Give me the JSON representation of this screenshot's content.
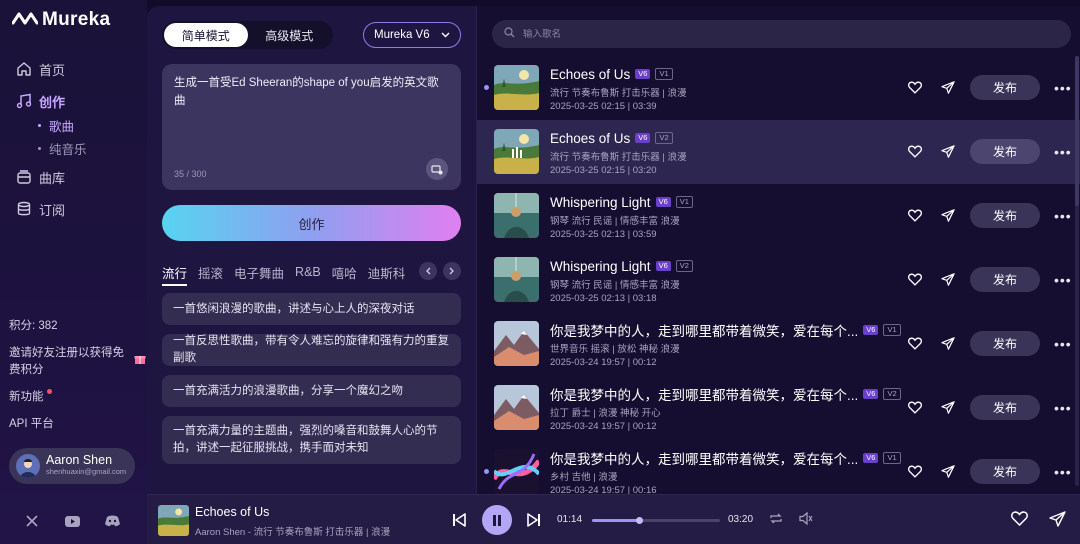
{
  "brand": {
    "name": "Mureka",
    "accent": "#c8a8ff"
  },
  "sidebar": {
    "nav": [
      {
        "label": "首页",
        "icon": "home-icon"
      },
      {
        "label": "创作",
        "icon": "music-note-icon",
        "active": true
      },
      {
        "label": "曲库",
        "icon": "library-icon"
      },
      {
        "label": "订阅",
        "icon": "database-icon"
      }
    ],
    "create_sub": [
      {
        "label": "歌曲",
        "active": true
      },
      {
        "label": "纯音乐"
      }
    ],
    "credits": "积分: 382",
    "invite": "邀请好友注册以获得免费积分",
    "new_features": "新功能",
    "api": "API 平台",
    "user": {
      "name": "Aaron Shen",
      "email": "shenhuaxin@gmail.com"
    },
    "socials": [
      "x-icon",
      "youtube-icon",
      "discord-icon"
    ]
  },
  "create": {
    "modes": [
      "简单模式",
      "高级模式"
    ],
    "active_mode": "简单模式",
    "model": "Mureka V6",
    "prompt": "生成一首受Ed Sheeran的shape of you启发的英文歌曲",
    "counter": "35 / 300",
    "create_label": "创作",
    "genres": [
      "流行",
      "摇滚",
      "电子舞曲",
      "R&B",
      "嘻哈",
      "迪斯科"
    ],
    "active_genre": "流行",
    "suggestions": [
      "一首悠闲浪漫的歌曲，讲述与心上人的深夜对话",
      "一首反思性歌曲，带有令人难忘的旋律和强有力的重复副歌",
      "一首充满活力的浪漫歌曲，分享一个魔幻之吻",
      "一首充满力量的主题曲，强烈的嗓音和鼓舞人心的节拍，讲述一起征服挑战，携手面对未知"
    ]
  },
  "library": {
    "search_placeholder": "输入歌名",
    "publish_label": "发布",
    "songs": [
      {
        "title": "Echoes of Us",
        "model": "V6",
        "version": "V1",
        "tags": "流行 节奏布鲁斯 打击乐器 | 浪漫",
        "stamp": "2025-03-25 02:15 | 03:39",
        "cover": "meadow",
        "dot": true
      },
      {
        "title": "Echoes of Us",
        "model": "V6",
        "version": "V2",
        "tags": "流行 节奏布鲁斯 打击乐器 | 浪漫",
        "stamp": "2025-03-25 02:15 | 03:20",
        "cover": "meadow",
        "selected": true
      },
      {
        "title": "Whispering Light",
        "model": "V6",
        "version": "V1",
        "tags": "钢琴 流行 民谣 | 情感丰富 浪漫",
        "stamp": "2025-03-25 02:13 | 03:59",
        "cover": "teal"
      },
      {
        "title": "Whispering Light",
        "model": "V6",
        "version": "V2",
        "tags": "钢琴 流行 民谣 | 情感丰富 浪漫",
        "stamp": "2025-03-25 02:13 | 03:18",
        "cover": "teal"
      },
      {
        "title": "你是我梦中的人，走到哪里都带着微笑，爱在每个...",
        "model": "V6",
        "version": "V1",
        "tags": "世界音乐 摇滚 | 放松 神秘 浪漫",
        "stamp": "2025-03-24 19:57 | 00:12",
        "cover": "mountain"
      },
      {
        "title": "你是我梦中的人，走到哪里都带着微笑，爱在每个...",
        "model": "V6",
        "version": "V2",
        "tags": "拉丁 爵士 | 浪漫 神秘 开心",
        "stamp": "2025-03-24 19:57 | 00:12",
        "cover": "mountain"
      },
      {
        "title": "你是我梦中的人，走到哪里都带着微笑，爱在每个...",
        "model": "V6",
        "version": "V1",
        "tags": "乡村 吉他 | 浪漫",
        "stamp": "2025-03-24 19:57 | 00:16",
        "cover": "aurora",
        "dot": true
      }
    ]
  },
  "player": {
    "title": "Echoes of Us",
    "subtitle": "Aaron Shen - 流行 节奏布鲁斯 打击乐器 | 浪漫",
    "elapsed": "01:14",
    "duration": "03:20",
    "progress": 0.37
  }
}
